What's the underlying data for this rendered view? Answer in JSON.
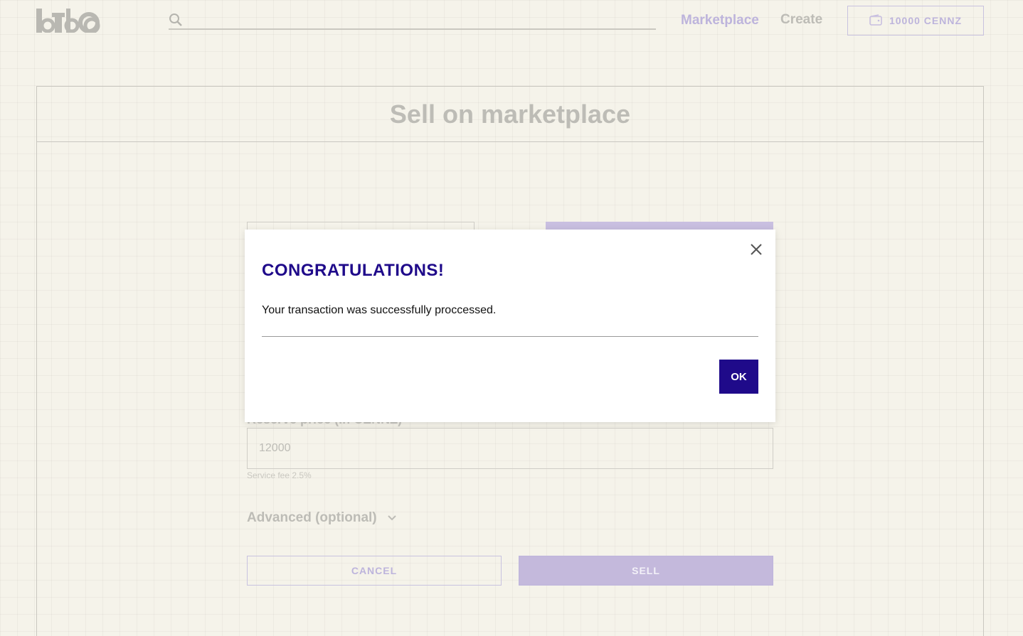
{
  "header": {
    "search": {
      "placeholder": "",
      "value": ""
    },
    "nav": {
      "marketplace": "Marketplace",
      "create": "Create"
    },
    "wallet": {
      "balance": "10000 CENNZ"
    }
  },
  "panel": {
    "title": "Sell on marketplace",
    "reserve_label": "Reserve price (in CENNZ)",
    "reserve_value": "12000",
    "service_fee": "Service fee 2.5%",
    "advanced": "Advanced (optional)",
    "cancel": "CANCEL",
    "sell": "SELL"
  },
  "modal": {
    "title": "CONGRATULATIONS!",
    "message": "Your transaction was successfully proccessed.",
    "ok": "OK"
  },
  "colors": {
    "accent": "#1f0a8a",
    "muted_accent": "#c4b9dc",
    "background": "#f5f3ea"
  }
}
